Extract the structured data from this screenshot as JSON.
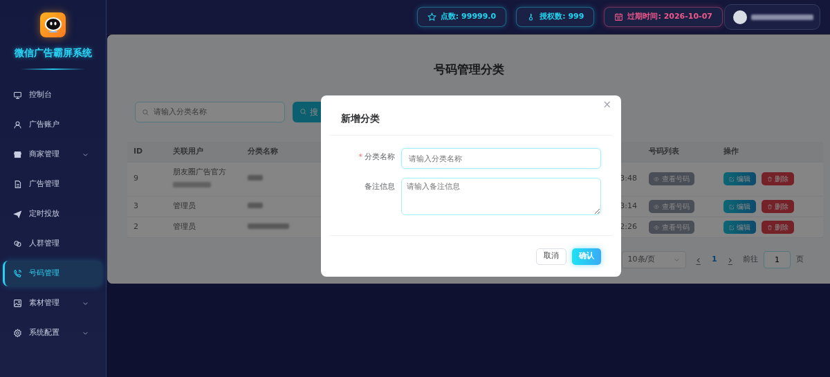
{
  "sidebar": {
    "title": "微信广告霸屏系统",
    "items": [
      {
        "label": "控制台",
        "kind": "link",
        "selected": false
      },
      {
        "label": "广告账户",
        "kind": "link",
        "selected": false
      },
      {
        "label": "商家管理",
        "kind": "group",
        "selected": false
      },
      {
        "label": "广告管理",
        "kind": "link",
        "selected": false
      },
      {
        "label": "定时投放",
        "kind": "link",
        "selected": false
      },
      {
        "label": "人群管理",
        "kind": "link",
        "selected": false
      },
      {
        "label": "号码管理",
        "kind": "link",
        "selected": true
      },
      {
        "label": "素材管理",
        "kind": "group",
        "selected": false
      },
      {
        "label": "系统配置",
        "kind": "group",
        "selected": false
      }
    ]
  },
  "header": {
    "stats": [
      {
        "label": "点数: 99999.0",
        "color": "#22d3ee"
      },
      {
        "label": "授权数: 999",
        "color": "#22d3ee"
      },
      {
        "label": "过期时间: 2026-10-07",
        "color": "#f0588a"
      }
    ]
  },
  "page": {
    "title": "号码管理分类",
    "search": {
      "placeholder": "请输入分类名称",
      "button": "搜"
    },
    "table": {
      "columns": [
        "ID",
        "关联用户",
        "分类名称",
        "号码列表",
        "操作"
      ],
      "rows": [
        {
          "id": "9",
          "user": "朋友圈广告官方",
          "time": "3:48",
          "view": "查看号码",
          "edit": "编辑",
          "delete": "删除"
        },
        {
          "id": "3",
          "user": "管理员",
          "time": "3:14",
          "view": "查看号码",
          "edit": "编辑",
          "delete": "删除"
        },
        {
          "id": "2",
          "user": "管理员",
          "time": "2:26",
          "view": "查看号码",
          "edit": "编辑",
          "delete": "删除"
        }
      ]
    },
    "pagination": {
      "page_size": "10条/页",
      "prev": "‹",
      "page": "1",
      "next": "›",
      "goto_label": "前往",
      "goto_value": "1",
      "goto_suffix": "页"
    }
  },
  "dialog": {
    "title": "新增分类",
    "close": "×",
    "fields": [
      {
        "label": "分类名称",
        "required_mark": "*",
        "placeholder": "请输入分类名称",
        "kind": "input"
      },
      {
        "label": "备注信息",
        "placeholder": "请输入备注信息",
        "kind": "textarea"
      }
    ],
    "buttons": [
      {
        "label": "取消",
        "kind": "secondary"
      },
      {
        "label": "确认",
        "kind": "primary"
      }
    ]
  }
}
